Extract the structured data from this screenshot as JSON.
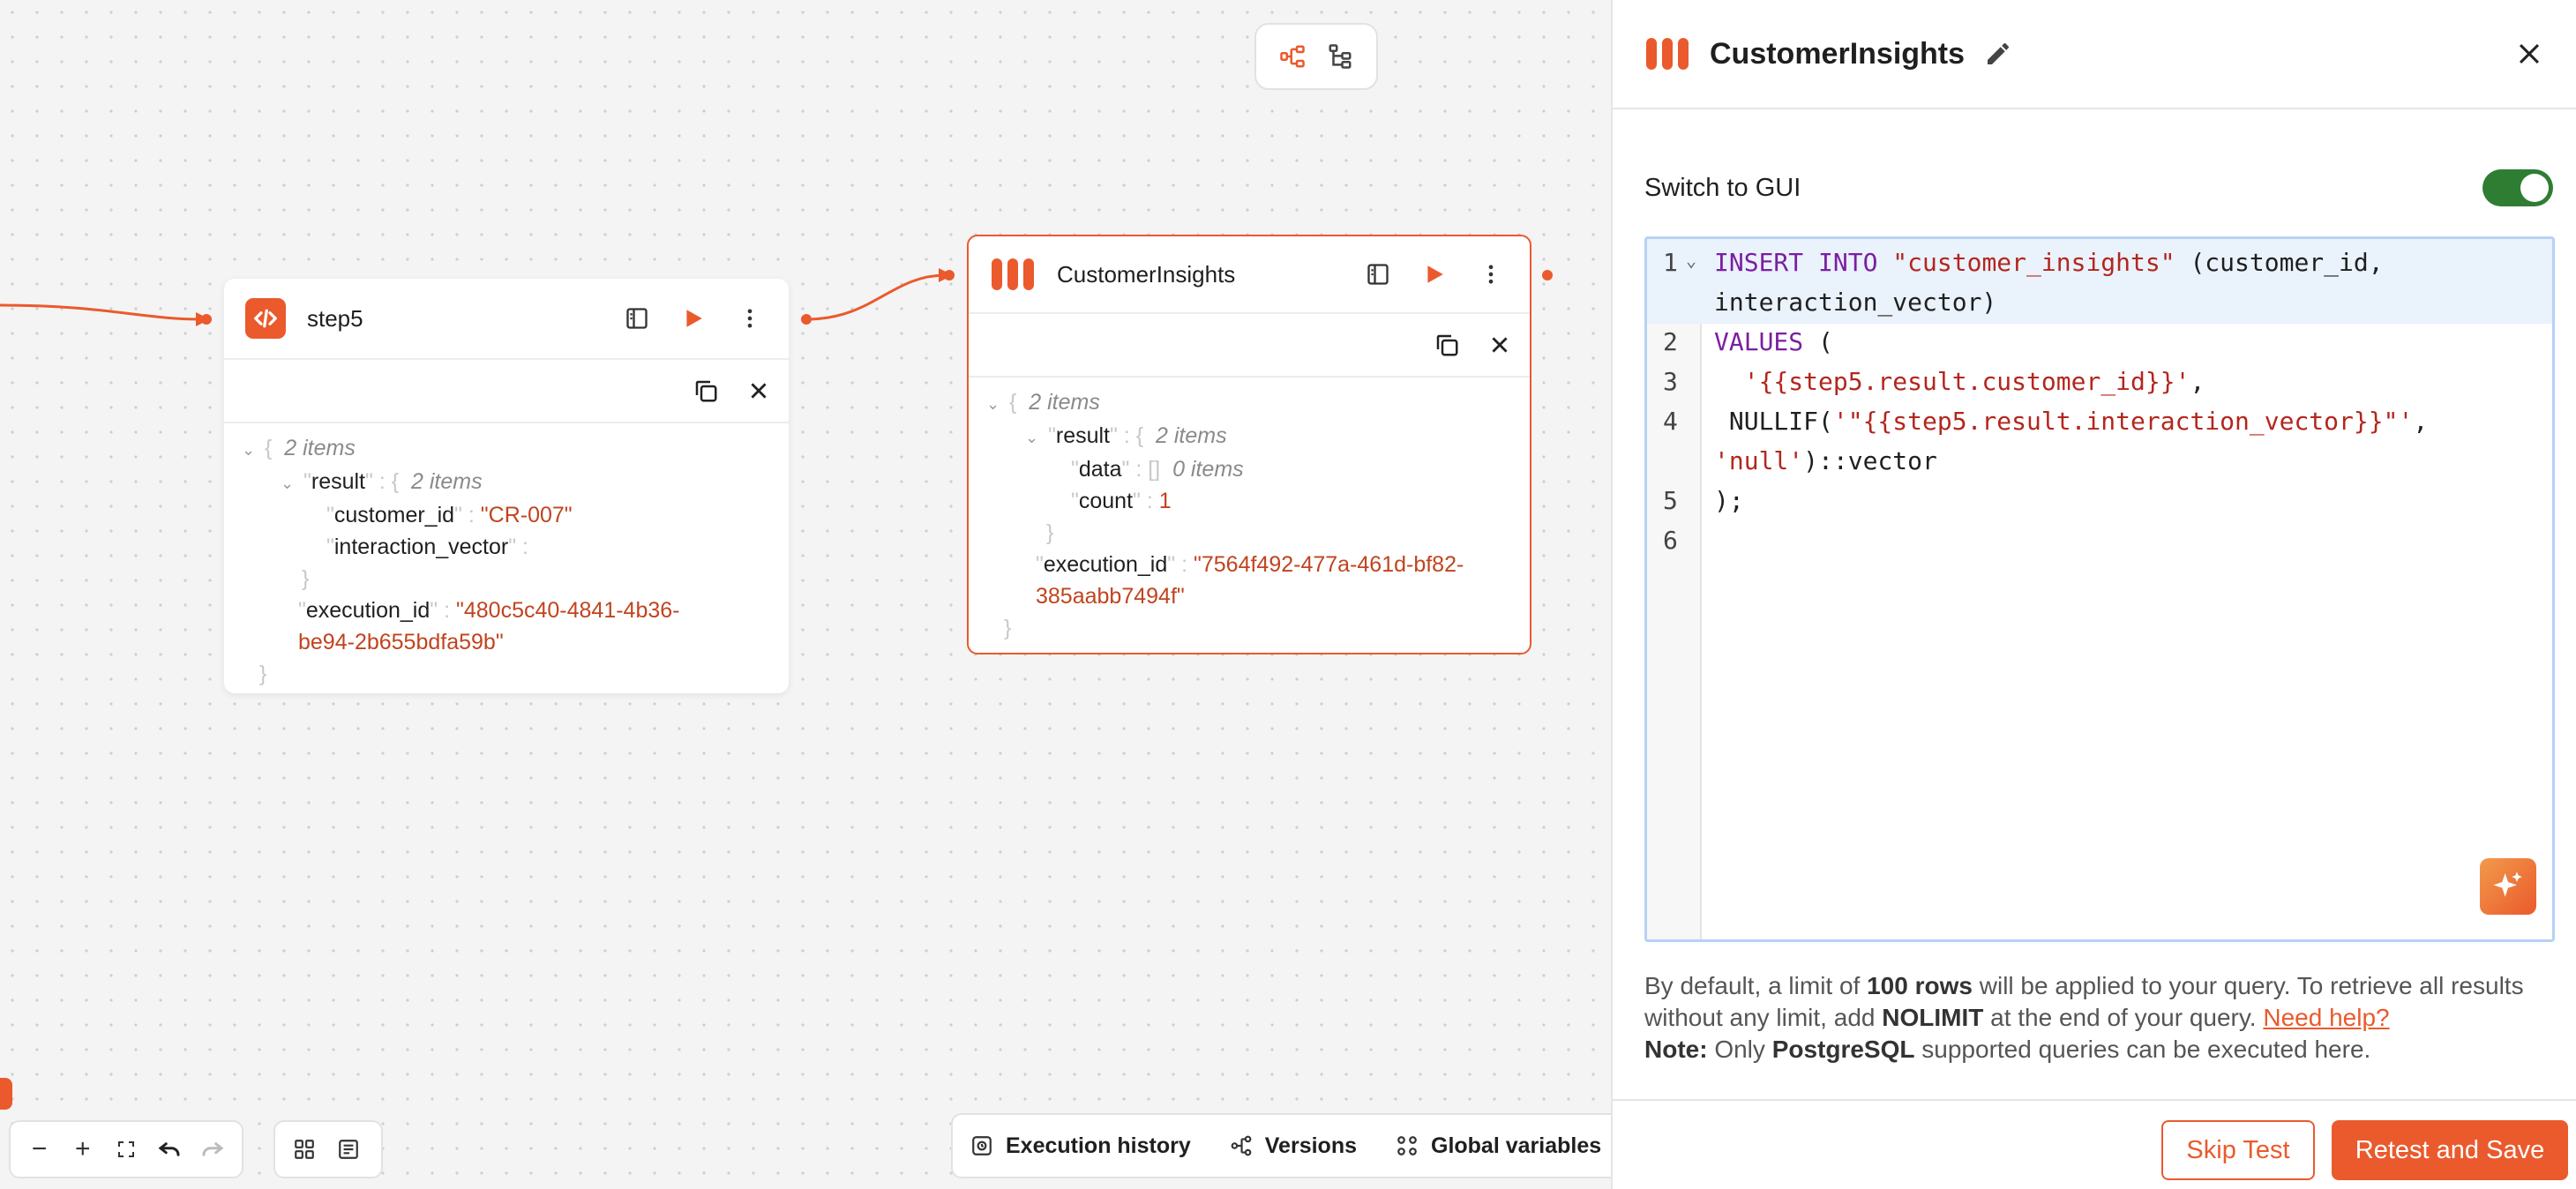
{
  "canvas": {
    "nodes": [
      {
        "title": "step5",
        "json": {
          "root_count": "2 items",
          "result_key": "result",
          "result_count": "2 items",
          "customer_id_key": "customer_id",
          "customer_id_value": "\"CR-007\"",
          "interaction_vector_key": "interaction_vector",
          "execution_id_key": "execution_id",
          "execution_id_line1": "\"480c5c40-4841-4b36-",
          "execution_id_line2": "be94-2b655bdfa59b\""
        }
      },
      {
        "title": "CustomerInsights",
        "json": {
          "root_count": "2 items",
          "result_key": "result",
          "result_count": "2 items",
          "data_key": "data",
          "data_count": "0 items",
          "count_key": "count",
          "count_value": "1",
          "execution_id_key": "execution_id",
          "execution_id_line1": "\"7564f492-477a-461d-bf82-",
          "execution_id_line2": "385aabb7494f\""
        }
      }
    ],
    "bottom_bar": {
      "execution_history": "Execution history",
      "versions": "Versions",
      "global_variables": "Global variables"
    },
    "zoom_controls": {
      "zoom_out": "−",
      "zoom_in": "+"
    }
  },
  "panel": {
    "title": "CustomerInsights",
    "switch_label": "Switch to GUI",
    "switch_on": true,
    "code_lines": [
      {
        "num": "1"
      },
      {
        "num": "2"
      },
      {
        "num": "3"
      },
      {
        "num": "4"
      },
      {
        "num": "5"
      },
      {
        "num": "6"
      }
    ],
    "note": {
      "p1": "By default, a limit of ",
      "b1": "100 rows",
      "p2": " will be applied to your query. To retrieve all results without any limit, add ",
      "b2": "NOLIMIT",
      "p3": " at the end of your query. ",
      "link": "Need help?",
      "note_label": "Note:",
      "p4": " Only ",
      "b3": "PostgreSQL",
      "p5": " supported queries can be executed here."
    },
    "buttons": {
      "skip": "Skip Test",
      "save": "Retest and Save"
    }
  },
  "colors": {
    "accent": "#ea5a2d",
    "toggle_on": "#2f7d32",
    "editor_border": "#b7d1f5"
  }
}
